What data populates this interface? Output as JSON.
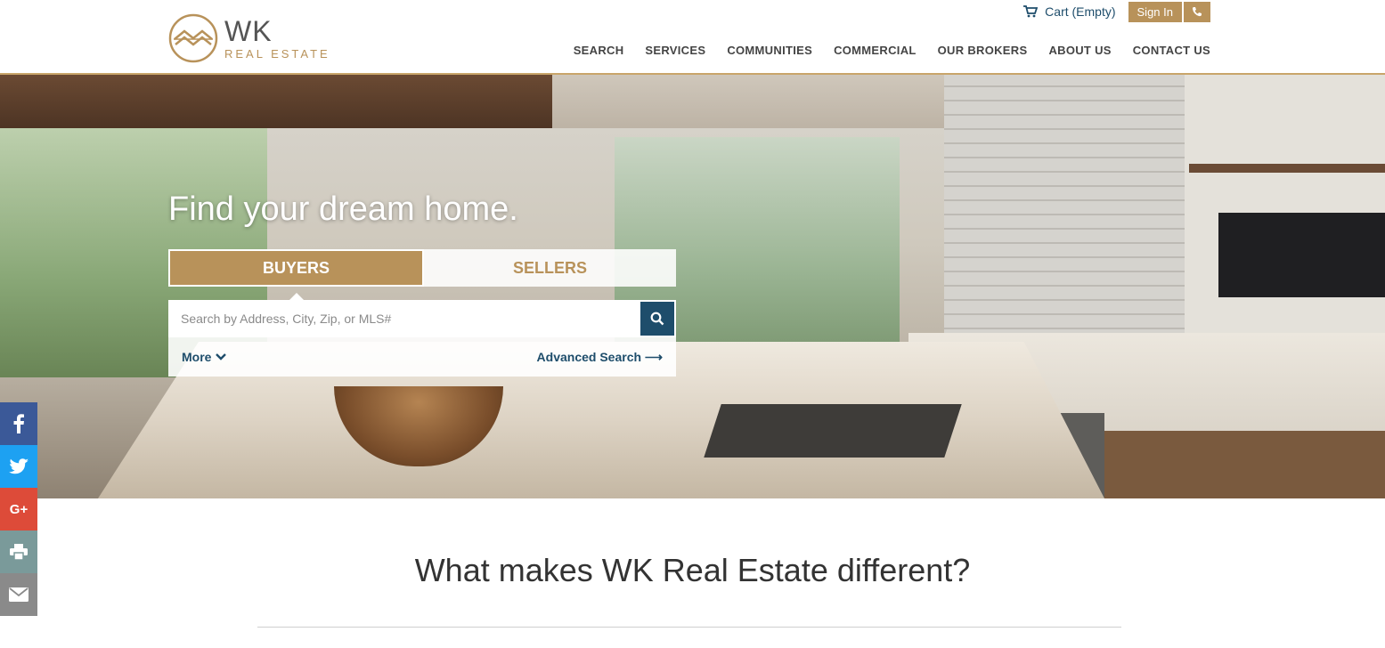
{
  "brand": {
    "name": "WK",
    "subtitle": "REAL ESTATE",
    "accent_color": "#b8925a",
    "link_color": "#1e4d6b"
  },
  "topbar": {
    "cart_label": "Cart (Empty)",
    "signin_label": "Sign In",
    "phone_icon": "phone-icon"
  },
  "nav": {
    "items": [
      "SEARCH",
      "SERVICES",
      "COMMUNITIES",
      "COMMERCIAL",
      "OUR BROKERS",
      "ABOUT US",
      "CONTACT US"
    ]
  },
  "hero": {
    "title": "Find your dream home.",
    "tabs": [
      "BUYERS",
      "SELLERS"
    ],
    "active_tab": "BUYERS",
    "search_placeholder": "Search by Address, City, Zip, or MLS#",
    "search_value": "",
    "more_label": "More",
    "advanced_label": "Advanced Search ⟶"
  },
  "social": {
    "items": [
      "facebook-icon",
      "twitter-icon",
      "google-plus-icon",
      "print-icon",
      "email-icon"
    ],
    "google_plus_label": "G+"
  },
  "section": {
    "title": "What makes WK Real Estate different?"
  }
}
